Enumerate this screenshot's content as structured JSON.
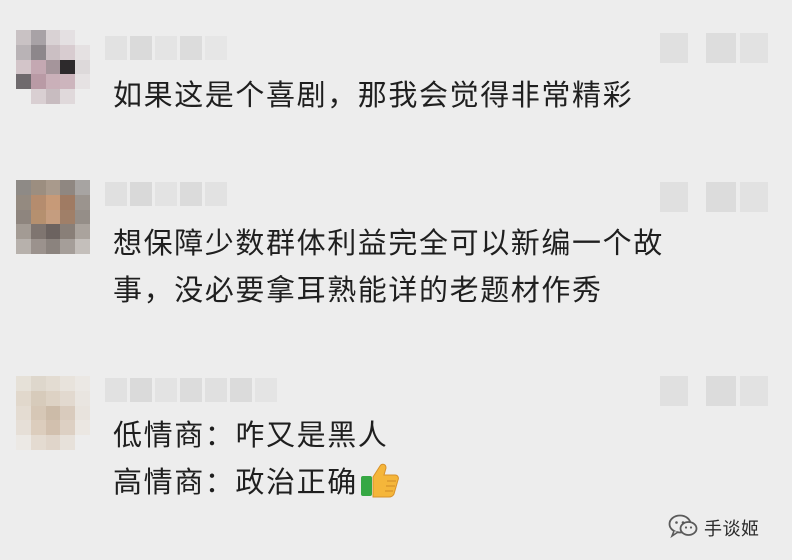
{
  "comments": [
    {
      "text_lines": [
        "如果这是个喜剧，那我会觉得非常精彩"
      ]
    },
    {
      "text_lines": [
        "想保障少数群体利益完全可以新编一个故",
        "事，没必要拿耳熟能详的老题材作秀"
      ]
    },
    {
      "text_lines": [
        "低情商：咋又是黑人",
        "高情商：政治正确"
      ],
      "trailing_icon": "thumbs-up-icon"
    }
  ],
  "watermark": {
    "icon": "wechat-icon",
    "text": "手谈姬"
  },
  "colors": {
    "background": "#ededed",
    "text": "#1f1f1f",
    "thumb_yellow": "#f5b63a",
    "thumb_green": "#36a844"
  }
}
